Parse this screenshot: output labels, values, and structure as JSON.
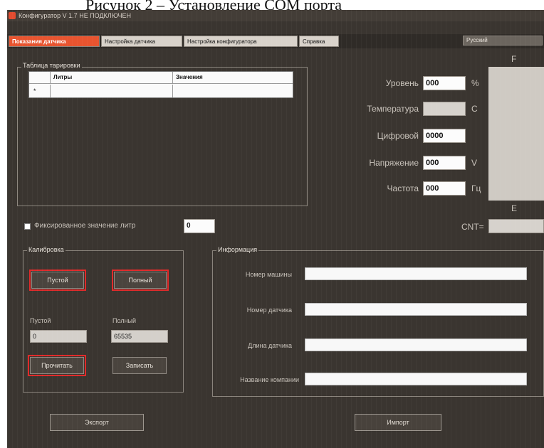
{
  "caption": "Рисунок 2 – Установление COM порта",
  "window": {
    "title": "Конфигуратор V 1.7 НЕ ПОДКЛЮЧЕН"
  },
  "tabs": [
    {
      "label": "Показания датчика",
      "active": true
    },
    {
      "label": "Настройка датчика",
      "active": false
    },
    {
      "label": "Настройка конфигуратора",
      "active": false
    },
    {
      "label": "Справка",
      "active": false
    }
  ],
  "language": {
    "selected": "Русский"
  },
  "calibration_table": {
    "group_label": "Таблица тарировки",
    "headers": [
      "Литры",
      "Значения"
    ],
    "rows": [
      {
        "marker": "*",
        "liters": "",
        "value": ""
      }
    ]
  },
  "readings": {
    "level": {
      "label": "Уровень",
      "value": "000",
      "unit": "%"
    },
    "temperature": {
      "label": "Температура",
      "value": "",
      "unit": "С"
    },
    "digital": {
      "label": "Цифровой",
      "value": "0000"
    },
    "voltage": {
      "label": "Напряжение",
      "value": "000",
      "unit": "V"
    },
    "frequency": {
      "label": "Частота",
      "value": "000",
      "unit": "Гц"
    }
  },
  "side_panel": {
    "top_label": "F",
    "bottom_label": "E",
    "cnt_label": "CNT="
  },
  "fixed_value": {
    "label": "Фиксированное значение литр",
    "value": "0"
  },
  "calibration": {
    "group_label": "Калибровка",
    "empty_button": "Пустой",
    "full_button": "Полный",
    "empty_label": "Пустой",
    "full_label": "Полный",
    "empty_value": "0",
    "full_value": "65535",
    "read_button": "Прочитать",
    "write_button": "Записать"
  },
  "info": {
    "group_label": "Информация",
    "fields": [
      {
        "label": "Номер машины"
      },
      {
        "label": "Номер датчика"
      },
      {
        "label": "Длина датчика"
      },
      {
        "label": "Название компании"
      }
    ]
  },
  "footer": {
    "export_button": "Экспорт",
    "import_button": "Импорт"
  },
  "colors": {
    "accent": "#e8542f",
    "highlight": "#e02a2a",
    "background": "#3a3530"
  }
}
